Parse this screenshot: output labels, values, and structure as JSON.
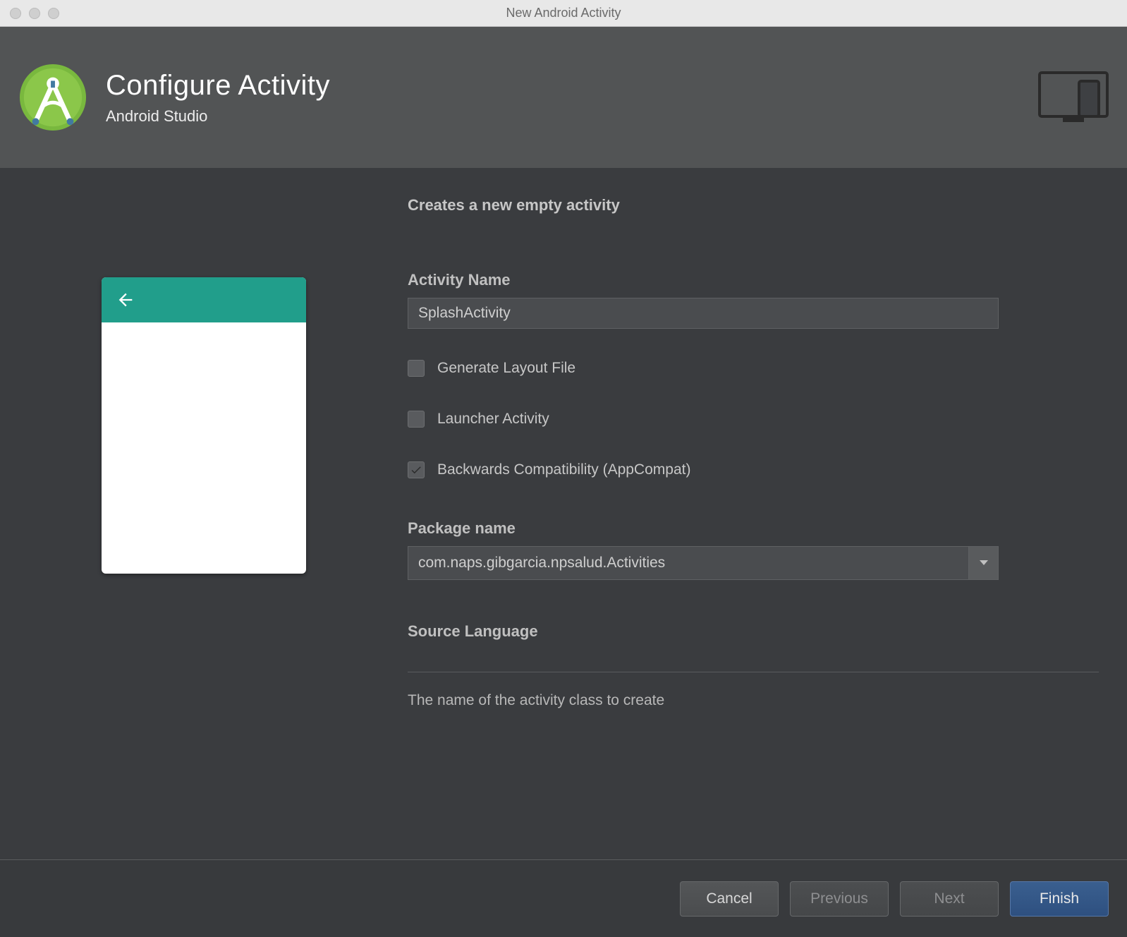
{
  "window": {
    "title": "New Android Activity"
  },
  "header": {
    "title": "Configure Activity",
    "subtitle": "Android Studio"
  },
  "form": {
    "description": "Creates a new empty activity",
    "activity_name_label": "Activity Name",
    "activity_name_value": "SplashActivity",
    "generate_layout_label": "Generate Layout File",
    "launcher_activity_label": "Launcher Activity",
    "backwards_compat_label": "Backwards Compatibility (AppCompat)",
    "package_name_label": "Package name",
    "package_name_value": "com.naps.gibgarcia.npsalud.Activities",
    "source_language_label": "Source Language",
    "help_text": "The name of the activity class to create"
  },
  "footer": {
    "cancel": "Cancel",
    "previous": "Previous",
    "next": "Next",
    "finish": "Finish"
  },
  "checkboxes": {
    "generate_layout": false,
    "launcher_activity": false,
    "backwards_compat": true
  }
}
